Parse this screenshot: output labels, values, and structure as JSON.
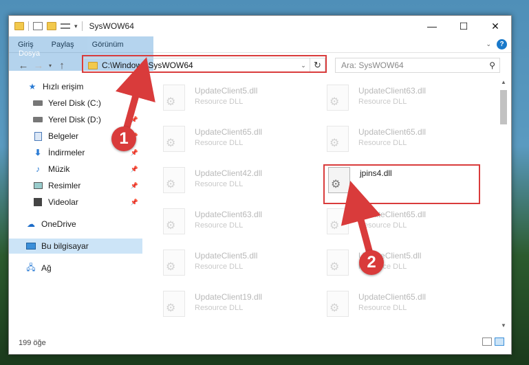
{
  "window": {
    "title": "SysWOW64"
  },
  "ribbon": {
    "tabs": [
      "Dosya",
      "Giriş",
      "Paylaş",
      "Görünüm"
    ]
  },
  "nav": {
    "address": "C:\\Windows\\SysWOW64",
    "search_placeholder": "Ara: SysWOW64"
  },
  "sidebar": {
    "items": [
      {
        "label": "Hızlı erişim",
        "icon": "star-icon"
      },
      {
        "label": "Yerel Disk (C:)",
        "icon": "drive-icon"
      },
      {
        "label": "Yerel Disk (D:)",
        "icon": "drive-icon"
      },
      {
        "label": "Belgeler",
        "icon": "document-icon"
      },
      {
        "label": "İndirmeler",
        "icon": "download-icon"
      },
      {
        "label": "Müzik",
        "icon": "music-icon"
      },
      {
        "label": "Resimler",
        "icon": "picture-icon"
      },
      {
        "label": "Videolar",
        "icon": "video-icon"
      },
      {
        "label": "OneDrive",
        "icon": "cloud-icon"
      },
      {
        "label": "Bu bilgisayar",
        "icon": "computer-icon"
      },
      {
        "label": "Ağ",
        "icon": "network-icon"
      }
    ]
  },
  "files": [
    {
      "name": "UpdateClient5.dll",
      "type": "Resource DLL"
    },
    {
      "name": "UpdateClient63.dll",
      "type": "Resource DLL"
    },
    {
      "name": "UpdateClient65.dll",
      "type": "Resource DLL"
    },
    {
      "name": "UpdateClient65.dll",
      "type": "Resource DLL"
    },
    {
      "name": "UpdateClient42.dll",
      "type": "Resource DLL"
    },
    {
      "name": "jpins4.dll",
      "type": ""
    },
    {
      "name": "UpdateClient63.dll",
      "type": "Resource DLL"
    },
    {
      "name": "UpdateClient65.dll",
      "type": "Resource DLL"
    },
    {
      "name": "UpdateClient5.dll",
      "type": "Resource DLL"
    },
    {
      "name": "UpdateClient5.dll",
      "type": "Resource DLL"
    },
    {
      "name": "UpdateClient19.dll",
      "type": "Resource DLL"
    },
    {
      "name": "UpdateClient65.dll",
      "type": "Resource DLL"
    }
  ],
  "status": {
    "count": "199 öğe"
  },
  "callouts": [
    "1",
    "2"
  ],
  "colors": {
    "accent": "#1979ca",
    "highlight": "#d93b3b",
    "selected": "#cce4f7"
  }
}
